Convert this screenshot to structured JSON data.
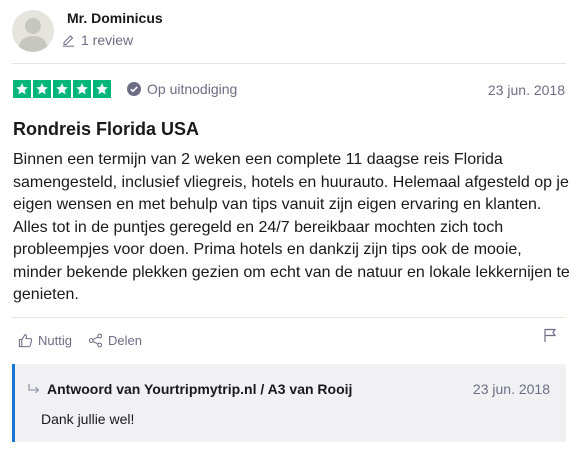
{
  "reviewer": {
    "name": "Mr. Dominicus",
    "review_count": "1 review"
  },
  "rating": {
    "stars": 5,
    "max_stars": 5,
    "color": "#00b67a"
  },
  "invited_label": "Op uitnodiging",
  "review_date": "23 jun. 2018",
  "review_title": "Rondreis Florida USA",
  "review_body": "Binnen een termijn van 2 weken een complete 11 daagse reis Florida samengesteld, inclusief vliegreis, hotels en huurauto. Helemaal afgesteld op je eigen wensen en met behulp van tips vanuit zijn eigen ervaring en klanten. Alles tot in de puntjes geregeld en 24/7 bereikbaar mochten zich toch probleempjes voor doen. Prima hotels en dankzij zijn tips ook de mooie, minder bekende plekken gezien om echt van de natuur en lokale lekkernijen te genieten.",
  "actions": {
    "useful_label": "Nuttig",
    "share_label": "Delen"
  },
  "reply": {
    "heading": "Antwoord van Yourtripmytrip.nl / A3 van Rooij",
    "date": "23 jun. 2018",
    "text": "Dank jullie wel!",
    "accent_color": "#1976d2"
  },
  "icons": {
    "avatar": "person-silhouette-icon",
    "review_count": "pencil-icon",
    "invited": "check-circle-icon",
    "useful": "thumbs-up-icon",
    "share": "share-icon",
    "flag": "flag-icon",
    "reply": "reply-arrow-icon"
  }
}
